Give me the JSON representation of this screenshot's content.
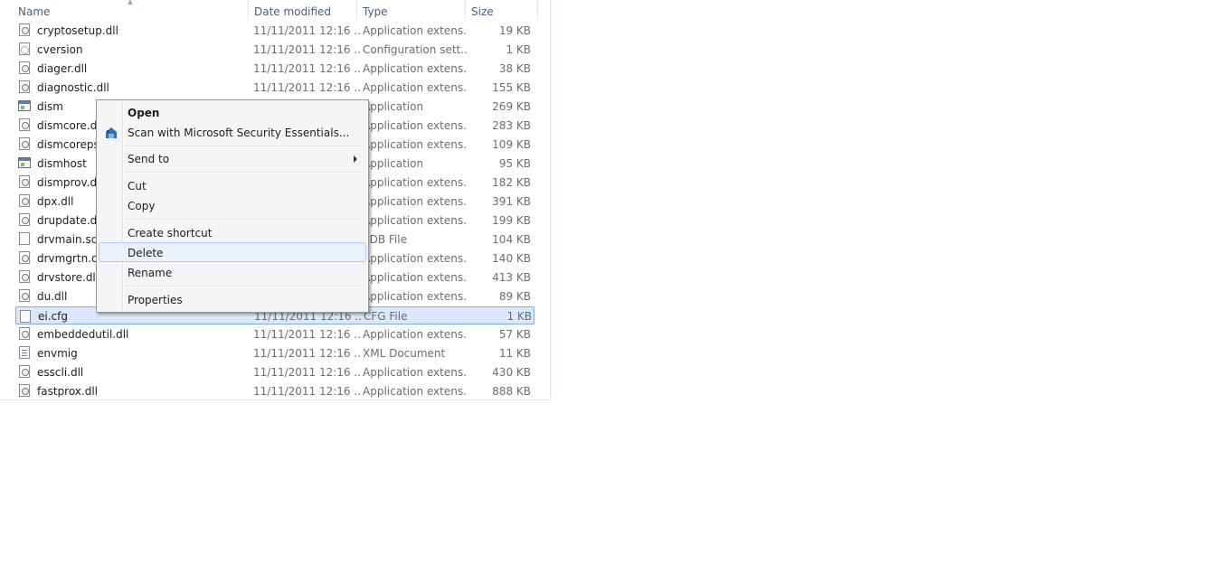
{
  "columns": {
    "name": "Name",
    "date_modified": "Date modified",
    "type": "Type",
    "size": "Size"
  },
  "files": [
    {
      "name": "cryptosetup.dll",
      "date": "11/11/2011 12:16 ...",
      "type": "Application extens...",
      "size": "19 KB",
      "icon": "dll-file-icon"
    },
    {
      "name": "cversion",
      "date": "11/11/2011 12:16 ...",
      "type": "Configuration sett...",
      "size": "1 KB",
      "icon": "config-file-icon"
    },
    {
      "name": "diager.dll",
      "date": "11/11/2011 12:16 ...",
      "type": "Application extens...",
      "size": "38 KB",
      "icon": "dll-file-icon"
    },
    {
      "name": "diagnostic.dll",
      "date": "11/11/2011 12:16 ...",
      "type": "Application extens...",
      "size": "155 KB",
      "icon": "dll-file-icon"
    },
    {
      "name": "dism",
      "date": "",
      "type": "Application",
      "size": "269 KB",
      "icon": "application-icon"
    },
    {
      "name": "dismcore.dll",
      "date": "",
      "type": "Application extens...",
      "size": "283 KB",
      "icon": "dll-file-icon"
    },
    {
      "name": "dismcoreps.",
      "date": "",
      "type": "Application extens...",
      "size": "109 KB",
      "icon": "dll-file-icon"
    },
    {
      "name": "dismhost",
      "date": "",
      "type": "Application",
      "size": "95 KB",
      "icon": "application-icon"
    },
    {
      "name": "dismprov.dll",
      "date": "",
      "type": "Application extens...",
      "size": "182 KB",
      "icon": "dll-file-icon"
    },
    {
      "name": "dpx.dll",
      "date": "",
      "type": "Application extens...",
      "size": "391 KB",
      "icon": "dll-file-icon"
    },
    {
      "name": "drupdate.dll",
      "date": "",
      "type": "Application extens...",
      "size": "199 KB",
      "icon": "dll-file-icon"
    },
    {
      "name": "drvmain.sdb",
      "date": "",
      "type": "SDB File",
      "size": "104 KB",
      "icon": "blank-file-icon"
    },
    {
      "name": "drvmgrtn.dll",
      "date": "",
      "type": "Application extens...",
      "size": "140 KB",
      "icon": "dll-file-icon"
    },
    {
      "name": "drvstore.dll",
      "date": "",
      "type": "Application extens...",
      "size": "413 KB",
      "icon": "dll-file-icon"
    },
    {
      "name": "du.dll",
      "date": "",
      "type": "Application extens...",
      "size": "89 KB",
      "icon": "dll-file-icon"
    },
    {
      "name": "ei.cfg",
      "date": "11/11/2011 12:16 ...",
      "type": "CFG File",
      "size": "1 KB",
      "icon": "blank-file-icon",
      "selected": true
    },
    {
      "name": "embeddedutil.dll",
      "date": "11/11/2011 12:16 ...",
      "type": "Application extens...",
      "size": "57 KB",
      "icon": "dll-file-icon"
    },
    {
      "name": "envmig",
      "date": "11/11/2011 12:16 ...",
      "type": "XML Document",
      "size": "11 KB",
      "icon": "xml-file-icon"
    },
    {
      "name": "esscli.dll",
      "date": "11/11/2011 12:16 ...",
      "type": "Application extens...",
      "size": "430 KB",
      "icon": "dll-file-icon"
    },
    {
      "name": "fastprox.dll",
      "date": "11/11/2011 12:16 ...",
      "type": "Application extens...",
      "size": "888 KB",
      "icon": "dll-file-icon"
    }
  ],
  "context_menu": {
    "open": "Open",
    "scan": "Scan with Microsoft Security Essentials...",
    "send_to": "Send to",
    "cut": "Cut",
    "copy": "Copy",
    "create_shortcut": "Create shortcut",
    "delete": "Delete",
    "rename": "Rename",
    "properties": "Properties"
  },
  "colors": {
    "selection_bg": "#d9e8fb",
    "selection_border": "#84acdd",
    "header_text": "#4c607a",
    "menu_hover_bg": "#e9f1fb"
  }
}
